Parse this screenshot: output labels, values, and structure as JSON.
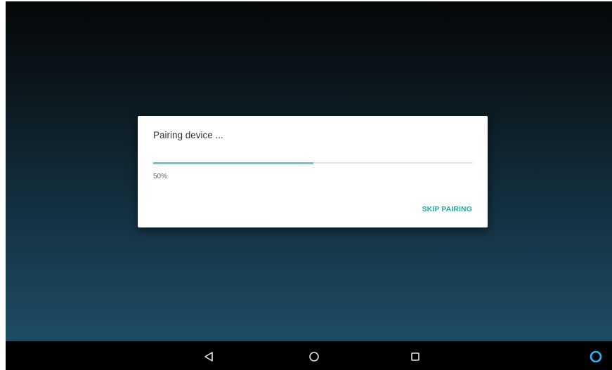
{
  "dialog": {
    "title": "Pairing device ...",
    "progress": {
      "value": 0.5,
      "label": "50%"
    },
    "skip_button_label": "SKIP PAIRING"
  },
  "nav_bar": {
    "items": [
      {
        "name": "back",
        "icon": "back-triangle-icon"
      },
      {
        "name": "home",
        "icon": "home-circle-icon"
      },
      {
        "name": "recents",
        "icon": "recents-square-icon"
      },
      {
        "name": "assistant",
        "icon": "assistant-ring-icon"
      }
    ]
  },
  "colors": {
    "accent": "#2ba9a4",
    "progress_fill": "#6ec3dd",
    "progress_track": "#dde3e6",
    "assistant_ring": "#29b6f6",
    "nav_icon": "#e0e0e0"
  }
}
